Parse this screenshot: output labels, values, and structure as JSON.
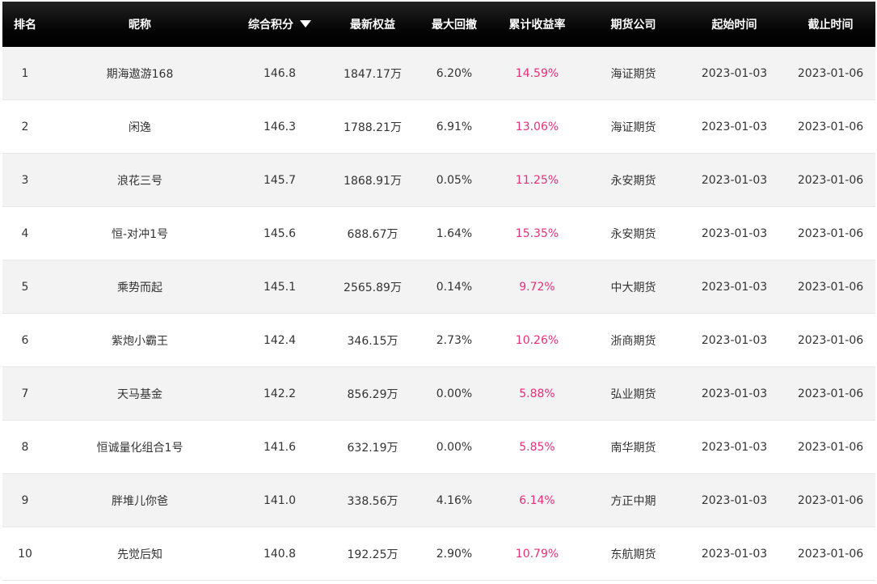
{
  "headers": [
    "排名",
    "昵称",
    "综合积分",
    "最新权益",
    "最大回撤",
    "累计收益率",
    "期货公司",
    "起始时间",
    "截止时间"
  ],
  "sort_icon": "caret-down-icon",
  "accent_color": "#e6307a",
  "rows": [
    {
      "rank": "1",
      "name": "期海遨游168",
      "score": "146.8",
      "equity": "1847.17万",
      "drawdown": "6.20%",
      "return": "14.59%",
      "company": "海证期货",
      "start": "2023-01-03",
      "end": "2023-01-06"
    },
    {
      "rank": "2",
      "name": "闲逸",
      "score": "146.3",
      "equity": "1788.21万",
      "drawdown": "6.91%",
      "return": "13.06%",
      "company": "海证期货",
      "start": "2023-01-03",
      "end": "2023-01-06"
    },
    {
      "rank": "3",
      "name": "浪花三号",
      "score": "145.7",
      "equity": "1868.91万",
      "drawdown": "0.05%",
      "return": "11.25%",
      "company": "永安期货",
      "start": "2023-01-03",
      "end": "2023-01-06"
    },
    {
      "rank": "4",
      "name": "恒-对冲1号",
      "score": "145.6",
      "equity": "688.67万",
      "drawdown": "1.64%",
      "return": "15.35%",
      "company": "永安期货",
      "start": "2023-01-03",
      "end": "2023-01-06"
    },
    {
      "rank": "5",
      "name": "乘势而起",
      "score": "145.1",
      "equity": "2565.89万",
      "drawdown": "0.14%",
      "return": "9.72%",
      "company": "中大期货",
      "start": "2023-01-03",
      "end": "2023-01-06"
    },
    {
      "rank": "6",
      "name": "紫炮小霸王",
      "score": "142.4",
      "equity": "346.15万",
      "drawdown": "2.73%",
      "return": "10.26%",
      "company": "浙商期货",
      "start": "2023-01-03",
      "end": "2023-01-06"
    },
    {
      "rank": "7",
      "name": "天马基金",
      "score": "142.2",
      "equity": "856.29万",
      "drawdown": "0.00%",
      "return": "5.88%",
      "company": "弘业期货",
      "start": "2023-01-03",
      "end": "2023-01-06"
    },
    {
      "rank": "8",
      "name": "恒诚量化组合1号",
      "score": "141.6",
      "equity": "632.19万",
      "drawdown": "0.00%",
      "return": "5.85%",
      "company": "南华期货",
      "start": "2023-01-03",
      "end": "2023-01-06"
    },
    {
      "rank": "9",
      "name": "胖堆儿你爸",
      "score": "141.0",
      "equity": "338.56万",
      "drawdown": "4.16%",
      "return": "6.14%",
      "company": "方正中期",
      "start": "2023-01-03",
      "end": "2023-01-06"
    },
    {
      "rank": "10",
      "name": "先觉后知",
      "score": "140.8",
      "equity": "192.25万",
      "drawdown": "2.90%",
      "return": "10.79%",
      "company": "东航期货",
      "start": "2023-01-03",
      "end": "2023-01-06"
    }
  ]
}
